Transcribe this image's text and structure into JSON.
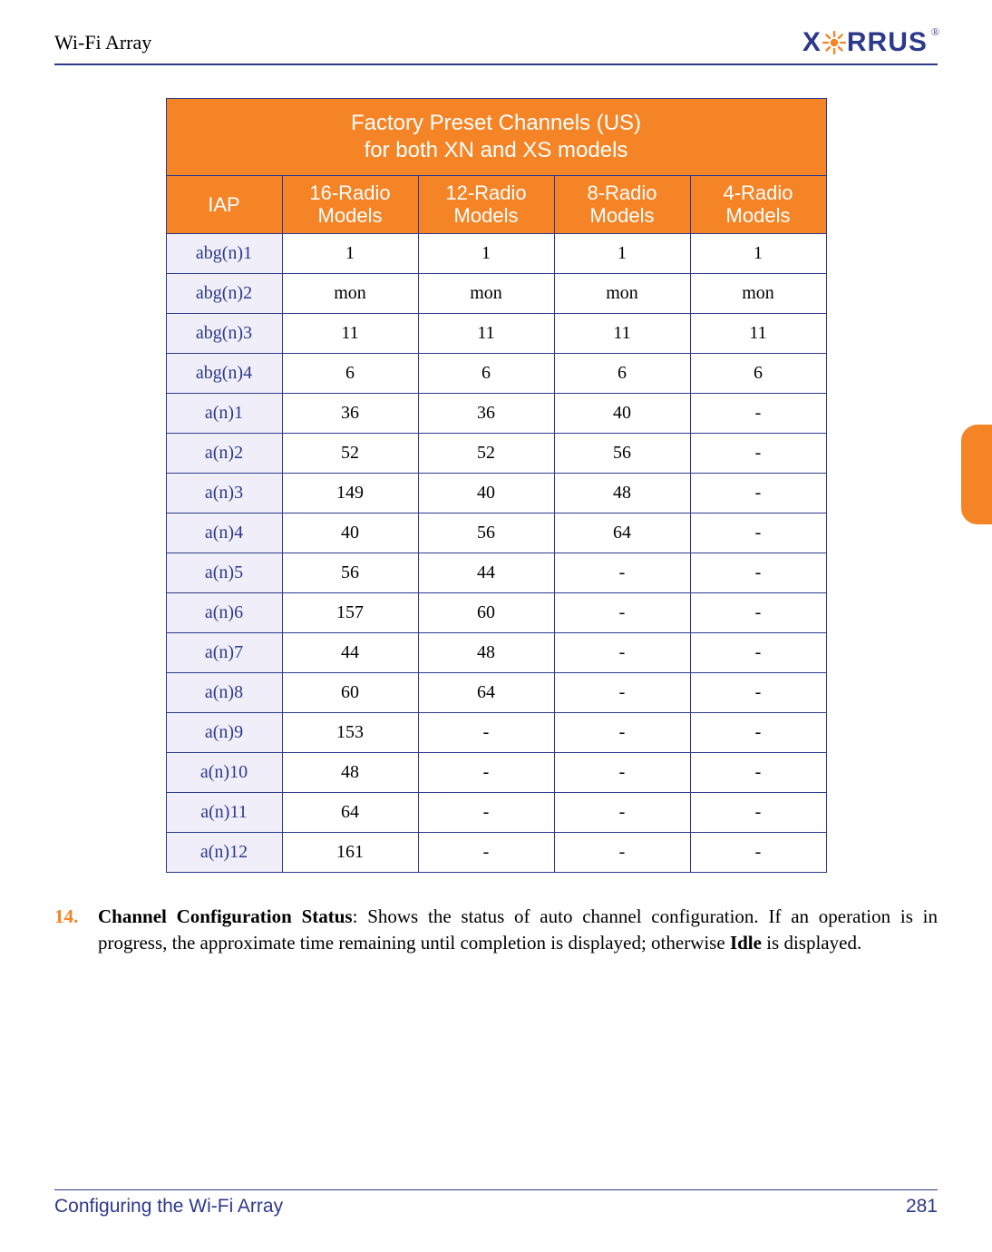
{
  "header": {
    "site_title": "Wi-Fi Array",
    "logo_text_left": "X",
    "logo_text_right": "RRUS",
    "logo_reg": "®"
  },
  "table": {
    "title_line1": "Factory Preset Channels (US)",
    "title_line2": "for both XN and XS models",
    "columns": {
      "iap": "IAP",
      "c16": "16-Radio Models",
      "c12": "12-Radio Models",
      "c8": "8-Radio Models",
      "c4": "4-Radio Models"
    },
    "rows": [
      {
        "iap": "abg(n)1",
        "c16": "1",
        "c12": "1",
        "c8": "1",
        "c4": "1"
      },
      {
        "iap": "abg(n)2",
        "c16": "mon",
        "c12": "mon",
        "c8": "mon",
        "c4": "mon"
      },
      {
        "iap": "abg(n)3",
        "c16": "11",
        "c12": "11",
        "c8": "11",
        "c4": "11"
      },
      {
        "iap": "abg(n)4",
        "c16": "6",
        "c12": "6",
        "c8": "6",
        "c4": "6"
      },
      {
        "iap": "a(n)1",
        "c16": "36",
        "c12": "36",
        "c8": "40",
        "c4": "-"
      },
      {
        "iap": "a(n)2",
        "c16": "52",
        "c12": "52",
        "c8": "56",
        "c4": "-"
      },
      {
        "iap": "a(n)3",
        "c16": "149",
        "c12": "40",
        "c8": "48",
        "c4": "-"
      },
      {
        "iap": "a(n)4",
        "c16": "40",
        "c12": "56",
        "c8": "64",
        "c4": "-"
      },
      {
        "iap": "a(n)5",
        "c16": "56",
        "c12": "44",
        "c8": "-",
        "c4": "-"
      },
      {
        "iap": "a(n)6",
        "c16": "157",
        "c12": "60",
        "c8": "-",
        "c4": "-"
      },
      {
        "iap": "a(n)7",
        "c16": "44",
        "c12": "48",
        "c8": "-",
        "c4": "-"
      },
      {
        "iap": "a(n)8",
        "c16": "60",
        "c12": "64",
        "c8": "-",
        "c4": "-"
      },
      {
        "iap": "a(n)9",
        "c16": "153",
        "c12": "-",
        "c8": "-",
        "c4": "-"
      },
      {
        "iap": "a(n)10",
        "c16": "48",
        "c12": "-",
        "c8": "-",
        "c4": "-"
      },
      {
        "iap": "a(n)11",
        "c16": "64",
        "c12": "-",
        "c8": "-",
        "c4": "-"
      },
      {
        "iap": "a(n)12",
        "c16": "161",
        "c12": "-",
        "c8": "-",
        "c4": "-"
      }
    ]
  },
  "list_item": {
    "number": "14.",
    "bold": "Channel Configuration Status",
    "rest": ": Shows the status of auto channel configuration. If an operation is in progress, the approximate time remaining until completion is displayed; otherwise ",
    "bold2": "Idle",
    "rest2": " is displayed."
  },
  "footer": {
    "left": "Configuring the Wi-Fi Array",
    "right": "281"
  }
}
